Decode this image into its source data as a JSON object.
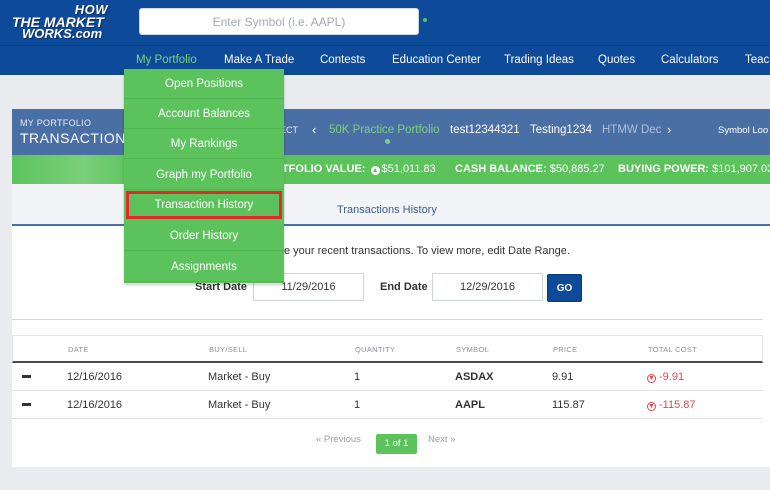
{
  "logo": {
    "line1": "HOW",
    "line2": "THE MARKET",
    "line3": "WORKS.com"
  },
  "search": {
    "placeholder": "Enter Symbol (i.e. AAPL)"
  },
  "nav": {
    "items": [
      "My Portfolio",
      "Make A Trade",
      "Contests",
      "Education Center",
      "Trading Ideas",
      "Quotes",
      "Calculators",
      "Teac"
    ]
  },
  "dropdown": {
    "items": [
      "Open Positions",
      "Account Balances",
      "My Rankings",
      "Graph my Portfolio",
      "Transaction History",
      "Order History",
      "Assignments"
    ]
  },
  "portfolio_header": {
    "small_label": "MY PORTFOLIO",
    "title": "TRANSACTIONS",
    "select_label": "ECT",
    "prev_icon": "chevron-left-icon",
    "next_icon": "chevron-right-icon",
    "portfolios": [
      "50K Practice Portfolio",
      "test12344321",
      "Testing1234",
      "HTMW Dec"
    ],
    "symbol_lookup": "Symbol Loo"
  },
  "summary": {
    "portfolio_value_label": "RTFOLIO VALUE:",
    "portfolio_value": "$51,011.83",
    "cash_balance_label": "CASH BALANCE:",
    "cash_balance": "$50,885.27",
    "buying_power_label": "BUYING POWER:",
    "buying_power": "$101,907.03"
  },
  "tab": {
    "label": "Transactions History"
  },
  "description": "e your recent transactions. To view more, edit Date Range.",
  "date_range": {
    "start_label": "Start Date",
    "start_value": "11/29/2016",
    "end_label": "End Date",
    "end_value": "12/29/2016",
    "go_label": "GO"
  },
  "table": {
    "headers": [
      "DATE",
      "BUY/SELL",
      "QUANTITY",
      "SYMBOL",
      "PRICE",
      "TOTAL COST"
    ],
    "rows": [
      {
        "date": "12/16/2016",
        "type": "Market - Buy",
        "quantity": "1",
        "symbol": "ASDAX",
        "price": "9.91",
        "total": "-9.91"
      },
      {
        "date": "12/16/2016",
        "type": "Market - Buy",
        "quantity": "1",
        "symbol": "AAPL",
        "price": "115.87",
        "total": "-115.87"
      }
    ]
  },
  "pager": {
    "previous": "« Previous",
    "current": "1 of 1",
    "next": "Next »"
  },
  "colors": {
    "brand_blue": "#0d4a9a",
    "green": "#5cc35c",
    "header_blue": "#4a6fa5",
    "negative": "#e04848",
    "highlight_border": "#e32a2a"
  }
}
